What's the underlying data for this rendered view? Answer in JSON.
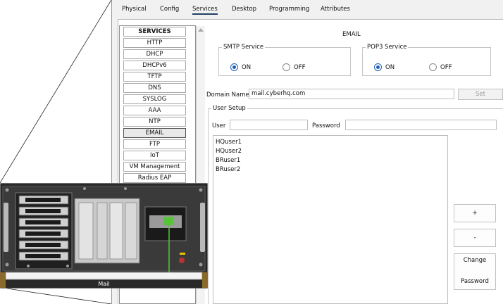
{
  "tabs": [
    "Physical",
    "Config",
    "Services",
    "Desktop",
    "Programming",
    "Attributes"
  ],
  "active_tab": "Services",
  "services": {
    "header": "SERVICES",
    "items": [
      "HTTP",
      "DHCP",
      "DHCPv6",
      "TFTP",
      "DNS",
      "SYSLOG",
      "AAA",
      "NTP",
      "EMAIL",
      "FTP",
      "IoT",
      "VM Management",
      "Radius EAP"
    ],
    "selected": "EMAIL"
  },
  "email": {
    "title": "EMAIL",
    "smtp": {
      "legend": "SMTP Service",
      "on_label": "ON",
      "off_label": "OFF",
      "value": "ON"
    },
    "pop3": {
      "legend": "POP3 Service",
      "on_label": "ON",
      "off_label": "OFF",
      "value": "ON"
    },
    "domain_label": "Domain Name:",
    "domain_value": "mail.cyberhq.com",
    "set_button": "Set",
    "user_setup": {
      "legend": "User Setup",
      "user_label": "User",
      "user_value": "",
      "password_label": "Password",
      "password_value": "",
      "users": [
        "HQuser1",
        "HQuser2",
        "BRuser1",
        "BRuser2"
      ],
      "add_button": "+",
      "remove_button": "-",
      "change_password_line1": "Change",
      "change_password_line2": "Password"
    }
  },
  "device": {
    "label": "Mail",
    "chassis_color": "#3a3a3a",
    "accent_color": "#8a6a2a",
    "link_color": "#58c23a"
  }
}
